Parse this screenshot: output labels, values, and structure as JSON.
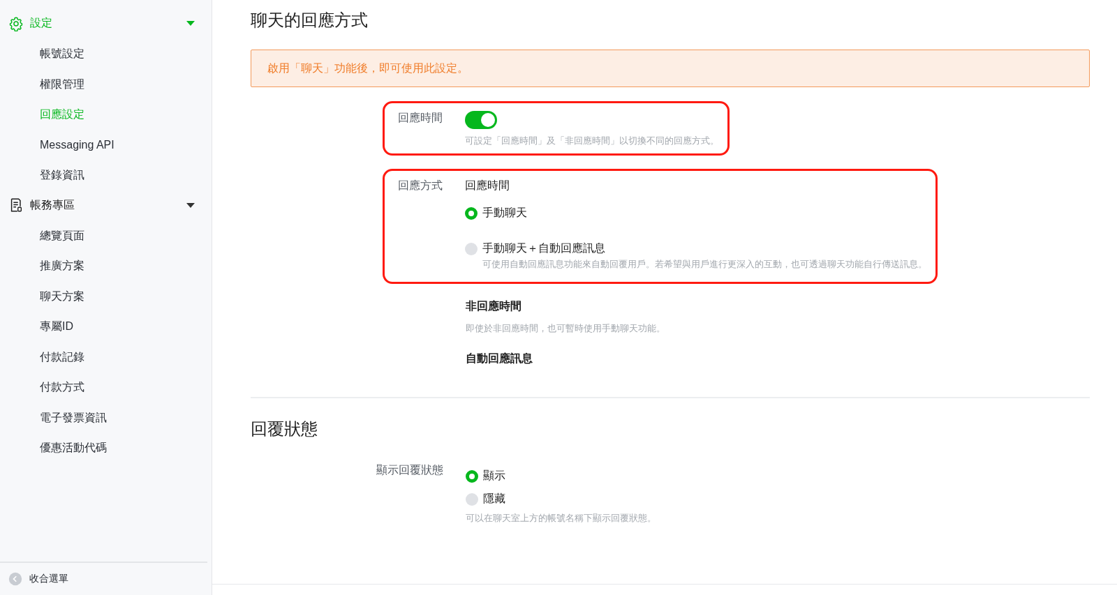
{
  "sidebar": {
    "groups": [
      {
        "label": "設定",
        "kind": "gear",
        "active": true,
        "expanded": true,
        "items": [
          {
            "label": "帳號設定",
            "selected": false
          },
          {
            "label": "權限管理",
            "selected": false
          },
          {
            "label": "回應設定",
            "selected": true
          },
          {
            "label": "Messaging API",
            "selected": false
          },
          {
            "label": "登錄資訊",
            "selected": false
          }
        ]
      },
      {
        "label": "帳務專區",
        "kind": "document",
        "active": false,
        "expanded": true,
        "items": [
          {
            "label": "總覽頁面",
            "selected": false
          },
          {
            "label": "推廣方案",
            "selected": false
          },
          {
            "label": "聊天方案",
            "selected": false
          },
          {
            "label": "專屬ID",
            "selected": false
          },
          {
            "label": "付款記錄",
            "selected": false
          },
          {
            "label": "付款方式",
            "selected": false
          },
          {
            "label": "電子發票資訊",
            "selected": false
          },
          {
            "label": "優惠活動代碼",
            "selected": false
          }
        ]
      }
    ],
    "collapse": {
      "label": "收合選單"
    }
  },
  "sections": [
    {
      "title": "聊天的回應方式",
      "alert": "啟用「聊天」功能後，即可使用此設定。",
      "rows": [
        {
          "kind": "toggle",
          "label": "回應時間",
          "on": true,
          "hint": "可設定「回應時間」及「非回應時間」以切換不同的回應方式。",
          "highlighted": true
        },
        {
          "kind": "radio",
          "label": "回應方式",
          "subtitle": "回應時間",
          "highlighted": true,
          "options": [
            {
              "label": "手動聊天",
              "selected": true
            },
            {
              "label": "手動聊天＋自動回應訊息",
              "selected": false,
              "hint": "可使用自動回應訊息功能來自動回覆用戶。若希望與用戶進行更深入的互動，也可透過聊天功能自行傳送訊息。"
            }
          ]
        },
        {
          "kind": "info",
          "heading": "非回應時間",
          "hint": "即使於非回應時間，也可暫時使用手動聊天功能。",
          "highlighted": false
        },
        {
          "kind": "info",
          "heading": "自動回應訊息",
          "highlighted": false
        }
      ]
    },
    {
      "title": "回覆狀態",
      "rows": [
        {
          "kind": "radio",
          "label": "顯示回覆狀態",
          "highlighted": false,
          "options": [
            {
              "label": "顯示",
              "selected": true
            },
            {
              "label": "隱藏",
              "selected": false
            }
          ],
          "hint": "可以在聊天室上方的帳號名稱下顯示回覆狀態。"
        }
      ]
    }
  ]
}
